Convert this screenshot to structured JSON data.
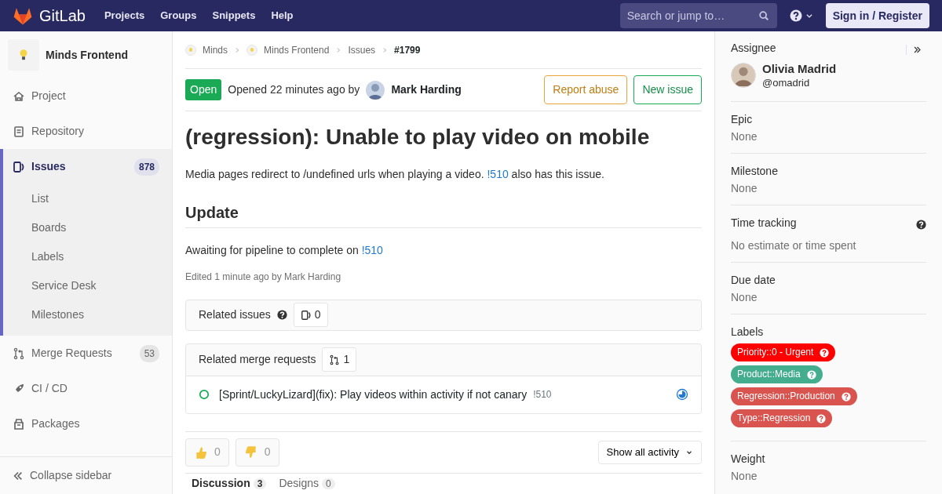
{
  "navbar": {
    "brand": "GitLab",
    "links": [
      "Projects",
      "Groups",
      "Snippets",
      "Help"
    ],
    "search": {
      "placeholder": "Search or jump to…"
    },
    "sign_in": "Sign in / Register"
  },
  "sidebar": {
    "project": "Minds Frontend",
    "items": [
      {
        "label": "Project",
        "selected": false
      },
      {
        "label": "Repository",
        "selected": false
      },
      {
        "label": "Issues",
        "selected": true,
        "count": "878",
        "children": [
          {
            "label": "List"
          },
          {
            "label": "Boards"
          },
          {
            "label": "Labels"
          },
          {
            "label": "Service Desk"
          },
          {
            "label": "Milestones"
          }
        ]
      },
      {
        "label": "Merge Requests",
        "selected": false,
        "count": "53"
      },
      {
        "label": "CI / CD",
        "selected": false
      },
      {
        "label": "Packages",
        "selected": false
      }
    ],
    "collapse": "Collapse sidebar"
  },
  "breadcrumbs": [
    {
      "label": "Minds",
      "kind": "avatar-link"
    },
    {
      "label": "Minds Frontend",
      "kind": "avatar-link"
    },
    {
      "label": "Issues",
      "kind": "link"
    },
    {
      "label": "#1799",
      "kind": "current"
    }
  ],
  "issue": {
    "status": "Open",
    "opened": "Opened 22 minutes ago by",
    "author": "Mark Harding",
    "buttons": [
      {
        "label": "Report abuse",
        "kind": "warning"
      },
      {
        "label": "New issue",
        "kind": "success"
      }
    ],
    "title": "(regression): Unable to play video on mobile",
    "description": {
      "before": "Media pages redirect to /undefined urls when playing a video.",
      "link": "!510",
      "after": "also has this issue."
    },
    "update_heading": "Update",
    "update_text": {
      "before": "Awaiting for pipeline to complete on",
      "link": "!510"
    },
    "edited": "Edited 1 minute ago by Mark Harding"
  },
  "related_issues": {
    "title": "Related issues",
    "count": "0"
  },
  "related_merge_requests": {
    "title": "Related merge requests",
    "count": "1",
    "items": [
      {
        "title": "[Sprint/LuckyLizard](fix): Play videos within activity if not canary",
        "ref": "!510"
      }
    ]
  },
  "reactions": [
    {
      "kind": "thumbs-up",
      "count": "0"
    },
    {
      "kind": "thumbs-down",
      "count": "0"
    }
  ],
  "activity_filter": "Show all activity",
  "tabs": [
    {
      "label": "Discussion",
      "count": "3",
      "selected": true
    },
    {
      "label": "Designs",
      "count": "0",
      "selected": false
    }
  ],
  "right_sidebar": {
    "assignee": {
      "heading": "Assignee",
      "name": "Olivia Madrid",
      "username": "@omadrid"
    },
    "sections": [
      {
        "kind": "value",
        "heading": "Epic",
        "value": "None"
      },
      {
        "kind": "value",
        "heading": "Milestone",
        "value": "None"
      },
      {
        "kind": "value",
        "heading": "Time tracking",
        "value": "No estimate or time spent",
        "help": true
      },
      {
        "kind": "value",
        "heading": "Due date",
        "value": "None"
      },
      {
        "kind": "labels",
        "heading": "Labels",
        "labels": [
          {
            "text": "Priority::0 - Urgent",
            "color": "#ff0000"
          },
          {
            "text": "Product::Media",
            "color": "#44ad8e"
          },
          {
            "text": "Regression::Production",
            "color": "#d9534f"
          },
          {
            "text": "Type::Regression",
            "color": "#d9534f"
          }
        ]
      },
      {
        "kind": "value",
        "heading": "Weight",
        "value": "None"
      }
    ]
  }
}
